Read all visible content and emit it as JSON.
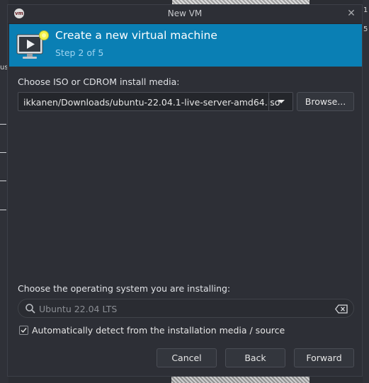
{
  "background": {
    "left_fragment": "us",
    "right_fragment_1": "1",
    "right_fragment_2": "5"
  },
  "window": {
    "title": "New VM",
    "logo_text": "vm"
  },
  "banner": {
    "heading": "Create a new virtual machine",
    "step": "Step 2 of 5",
    "color": "#0a7fb4"
  },
  "install_media": {
    "label": "Choose ISO or CDROM install media:",
    "value": "ikkanen/Downloads/ubuntu-22.04.1-live-server-amd64.iso",
    "browse_label": "Browse..."
  },
  "os": {
    "label": "Choose the operating system you are installing:",
    "search_placeholder": "Ubuntu 22.04 LTS",
    "autodetect_label": "Automatically detect from the installation media / source",
    "autodetect_checked": true
  },
  "buttons": {
    "cancel": "Cancel",
    "back": "Back",
    "forward": "Forward"
  },
  "icons": {
    "vm": "monitor-play-icon",
    "dropdown": "chevron-down-icon",
    "search": "search-icon",
    "clear": "clear-icon",
    "close": "close-icon"
  }
}
